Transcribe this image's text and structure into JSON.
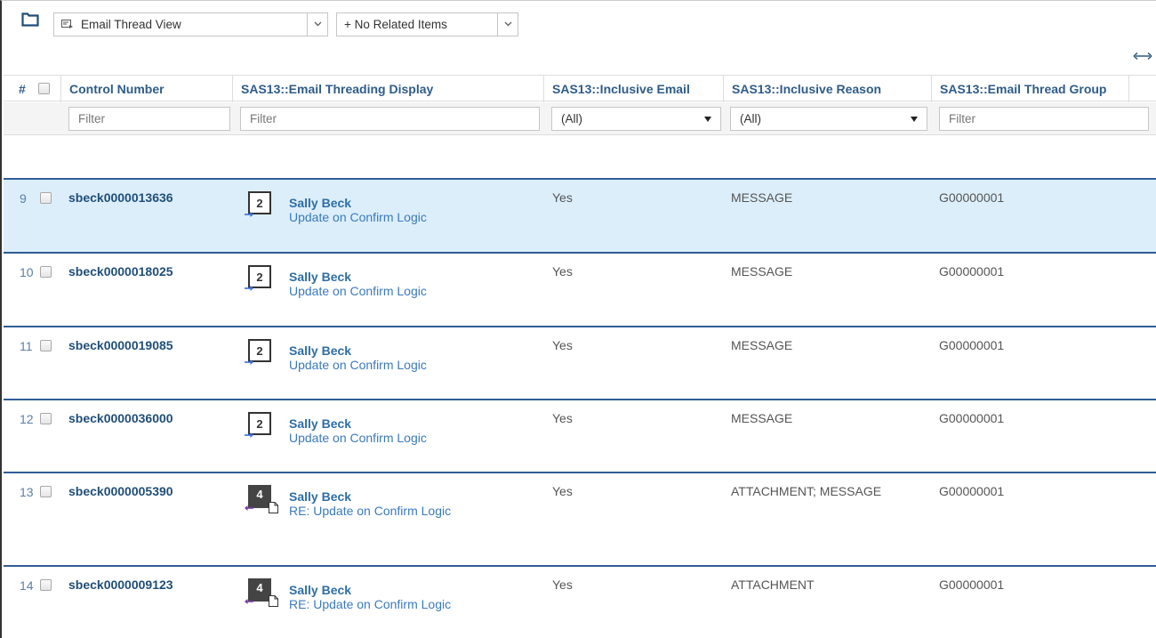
{
  "toolbar": {
    "view_label": "Email Thread View",
    "related_label": "+ No Related Items"
  },
  "columns": {
    "number": "#",
    "control_number": "Control Number",
    "threading_display": "SAS13::Email Threading Display",
    "inclusive_email": "SAS13::Inclusive Email",
    "inclusive_reason": "SAS13::Inclusive Reason",
    "thread_group": "SAS13::Email Thread Group"
  },
  "filters": {
    "control_number": "Filter",
    "threading_display": "Filter",
    "inclusive_email": "(All)",
    "inclusive_reason": "(All)",
    "thread_group": "Filter"
  },
  "rows": [
    {
      "num": "9",
      "control": "sbeck0000013636",
      "count": "2",
      "sender": "Sally Beck",
      "subject": "Update on Confirm Logic",
      "inclusive": "Yes",
      "reason": "MESSAGE",
      "group": "G00000001",
      "selected": true,
      "style": "light"
    },
    {
      "num": "10",
      "control": "sbeck0000018025",
      "count": "2",
      "sender": "Sally Beck",
      "subject": "Update on Confirm Logic",
      "inclusive": "Yes",
      "reason": "MESSAGE",
      "group": "G00000001",
      "selected": false,
      "style": "light"
    },
    {
      "num": "11",
      "control": "sbeck0000019085",
      "count": "2",
      "sender": "Sally Beck",
      "subject": "Update on Confirm Logic",
      "inclusive": "Yes",
      "reason": "MESSAGE",
      "group": "G00000001",
      "selected": false,
      "style": "light"
    },
    {
      "num": "12",
      "control": "sbeck0000036000",
      "count": "2",
      "sender": "Sally Beck",
      "subject": "Update on Confirm Logic",
      "inclusive": "Yes",
      "reason": "MESSAGE",
      "group": "G00000001",
      "selected": false,
      "style": "light"
    },
    {
      "num": "13",
      "control": "sbeck0000005390",
      "count": "4",
      "sender": "Sally Beck",
      "subject": "RE: Update on Confirm Logic",
      "inclusive": "Yes",
      "reason": "ATTACHMENT; MESSAGE",
      "group": "G00000001",
      "selected": false,
      "style": "dark"
    },
    {
      "num": "14",
      "control": "sbeck0000009123",
      "count": "4",
      "sender": "Sally Beck",
      "subject": "RE: Update on Confirm Logic",
      "inclusive": "Yes",
      "reason": "ATTACHMENT",
      "group": "G00000001",
      "selected": false,
      "style": "dark"
    }
  ],
  "colors": {
    "header_text": "#2e5c8a",
    "row_separator": "#2f5d94",
    "selected_row": "#dceefa",
    "link": "#3a7abf"
  }
}
